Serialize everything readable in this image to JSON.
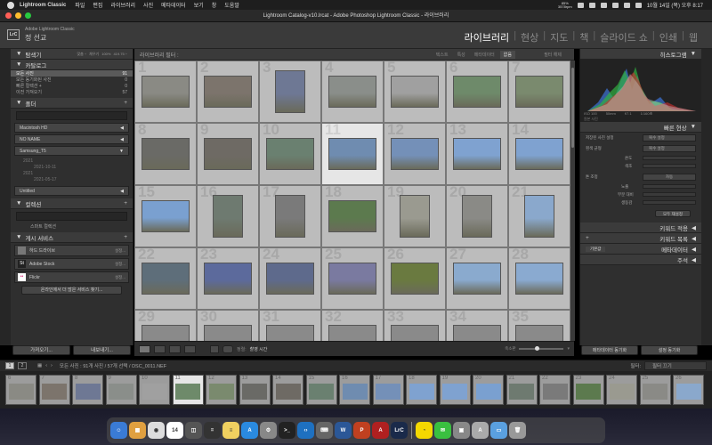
{
  "menubar": {
    "app": "Lightroom Classic",
    "items": [
      "파일",
      "편집",
      "라이브러리",
      "사진",
      "메타데이터",
      "보기",
      "창",
      "도움말"
    ],
    "status_top": "85%",
    "status_bottom": "3578rpm",
    "clock": "10월 14일 (목) 오후 8:17"
  },
  "window": {
    "title": "Lightroom Catalog-v10.lrcat - Adobe Photoshop Lightroom Classic - 라이브러리"
  },
  "identity": {
    "logo": "LrC",
    "brand": "Adobe Lightroom Classic",
    "user": "정 선교"
  },
  "modules": [
    "라이브러리",
    "현상",
    "지도",
    "책",
    "슬라이드 쇼",
    "인쇄",
    "웹"
  ],
  "active_module": "라이브러리",
  "left": {
    "navigator": {
      "title": "탐색기",
      "zoom": [
        "맞춤 ÷",
        "채우기",
        "100%",
        "419.75 ÷"
      ]
    },
    "catalog": {
      "title": "카탈로그",
      "items": [
        {
          "label": "모든 사진",
          "count": "91",
          "selected": true
        },
        {
          "label": "모든 동기화된 사진",
          "count": "0"
        },
        {
          "label": "빠른 컬렉션 +",
          "count": "0"
        },
        {
          "label": "이전 가져오기",
          "count": "57"
        }
      ]
    },
    "folders": {
      "title": "폴더",
      "volumes": [
        "Macintosh HD",
        "NO NAME",
        "Samsung_T5",
        "Untitled"
      ],
      "sub": [
        "2021",
        "2021-10-11",
        "2021",
        "2021-05-17"
      ]
    },
    "collections": {
      "title": "컬렉션",
      "items": [
        "스마트 컬렉션"
      ]
    },
    "publish": {
      "title": "게시 서비스",
      "items": [
        {
          "badge": "",
          "label": "하드 드라이브",
          "set": "설정..."
        },
        {
          "badge": "St",
          "label": "Adobe Stock",
          "set": "설정..."
        },
        {
          "badge": "••",
          "label": "Flickr",
          "set": "설정..."
        }
      ],
      "find_more": "온라인에서 더 많은 서비스 찾기..."
    },
    "import_btn": "가져오기...",
    "export_btn": "내보내기..."
  },
  "filter": {
    "label": "라이브러리 필터 :",
    "tabs": [
      "텍스트",
      "특성",
      "메타데이터",
      "없음"
    ],
    "active_tab": "없음",
    "filter_off": "필터 해제"
  },
  "grid": {
    "cells": [
      {
        "n": "1",
        "c": "#8a8a84"
      },
      {
        "n": "2",
        "c": "#7c746c"
      },
      {
        "n": "3",
        "c": "#6e7894",
        "p": true
      },
      {
        "n": "4",
        "c": "#8a8e8a"
      },
      {
        "n": "5",
        "c": "#a0a0a0"
      },
      {
        "n": "6",
        "c": "#6e8a6a"
      },
      {
        "n": "7",
        "c": "#7a8a6e"
      },
      {
        "n": "8",
        "c": "#6a6a66"
      },
      {
        "n": "9",
        "c": "#6e6a64"
      },
      {
        "n": "10",
        "c": "#6a8070"
      },
      {
        "n": "11",
        "c": "#6f8cb0"
      },
      {
        "n": "12",
        "c": "#7490b8"
      },
      {
        "n": "13",
        "c": "#7fa2d0"
      },
      {
        "n": "14",
        "c": "#7fa2d0"
      },
      {
        "n": "15",
        "c": "#7aa0d0"
      },
      {
        "n": "16",
        "c": "#6e7a70",
        "p": true
      },
      {
        "n": "17",
        "c": "#7a7a7a",
        "p": true
      },
      {
        "n": "18",
        "c": "#5c7a4e"
      },
      {
        "n": "19",
        "c": "#9a9a90",
        "p": true
      },
      {
        "n": "20",
        "c": "#8a8a86",
        "p": true
      },
      {
        "n": "21",
        "c": "#8aa8cc",
        "p": true
      },
      {
        "n": "22",
        "c": "#5e6e7a"
      },
      {
        "n": "23",
        "c": "#5c6a9c"
      },
      {
        "n": "24",
        "c": "#5e6a8c"
      },
      {
        "n": "25",
        "c": "#7a7aa0"
      },
      {
        "n": "26",
        "c": "#6a7a40"
      },
      {
        "n": "27",
        "c": "#8aaace"
      },
      {
        "n": "28",
        "c": "#8aaad0"
      },
      {
        "n": "29",
        "c": "#8a8a8a"
      },
      {
        "n": "30",
        "c": "#8a8a8a"
      },
      {
        "n": "31",
        "c": "#8a8a8a"
      },
      {
        "n": "32",
        "c": "#8a8a8a"
      },
      {
        "n": "33",
        "c": "#8a8a8a"
      },
      {
        "n": "34",
        "c": "#8a8a8a"
      },
      {
        "n": "35",
        "c": "#8a8a8a"
      }
    ],
    "selected": "11"
  },
  "toolbar": {
    "sort_label": "정렬:",
    "sort_value": "촬영 시간",
    "thumb_label": "축소판"
  },
  "right": {
    "histogram": {
      "title": "히스토그램",
      "readout": [
        "ISO 100",
        "50mm",
        "f/7.1",
        "1/160초"
      ],
      "orig": "원본 사진"
    },
    "quick_develop": {
      "title": "빠른 현상",
      "saved_preset": {
        "label": "저장된 사진 설정",
        "value": "복수 설정"
      },
      "white_balance": {
        "label": "흰색 균형",
        "value": "복수 설정"
      },
      "wb_rows": [
        "온도",
        "색조"
      ],
      "tone": {
        "label": "톤 조정",
        "value": "자동"
      },
      "tone_rows": [
        "노출",
        "부분 대비",
        "생동감"
      ],
      "reset": "모두 재설정"
    },
    "sections": [
      "키워드 적용",
      "키워드 목록",
      "메타데이터",
      "주석"
    ],
    "metadata_default": "기본값",
    "metadata_value": "복수 설정",
    "sync_meta": "메타데이터 동기화",
    "sync_settings": "설정 동기화"
  },
  "filmstrip_bar": {
    "pages": [
      "1",
      "2"
    ],
    "path": "모든 사진 : 91개 사진 / 57개 선택 / DSC_0011.NEF",
    "filter_label": "필터:",
    "filter_value": "필터 끄기"
  },
  "filmstrip": [
    "6",
    "7",
    "8",
    "9",
    "10",
    "11",
    "12",
    "13",
    "14",
    "15",
    "16",
    "17",
    "18",
    "19",
    "20",
    "21",
    "22",
    "23",
    "24",
    "25",
    "26"
  ],
  "dock": [
    {
      "n": "Finder",
      "c": "#3a7bd5",
      "t": "☺"
    },
    {
      "n": "Launchpad",
      "c": "#e0a040",
      "t": "▦"
    },
    {
      "n": "Chrome",
      "c": "#dddddd",
      "t": "◉"
    },
    {
      "n": "Calendar",
      "c": "#ffffff",
      "t": "14"
    },
    {
      "n": "Screenshot",
      "c": "#555555",
      "t": "◫"
    },
    {
      "n": "Calculator",
      "c": "#333333",
      "t": "="
    },
    {
      "n": "Notes",
      "c": "#f0d060",
      "t": "≡"
    },
    {
      "n": "AppStore",
      "c": "#2a8ae0",
      "t": "A"
    },
    {
      "n": "Settings",
      "c": "#888888",
      "t": "⚙"
    },
    {
      "n": "Terminal",
      "c": "#222222",
      "t": ">_"
    },
    {
      "n": "VSCode",
      "c": "#1e70c0",
      "t": "‹›"
    },
    {
      "n": "Keyboard",
      "c": "#666666",
      "t": "⌨"
    },
    {
      "n": "Word",
      "c": "#2b5797",
      "t": "W"
    },
    {
      "n": "PowerPoint",
      "c": "#c04020",
      "t": "P"
    },
    {
      "n": "Acrobat",
      "c": "#b02020",
      "t": "A"
    },
    {
      "n": "Lightroom",
      "c": "#1a2a4a",
      "t": "LrC"
    },
    {
      "n": "KakaoTalk",
      "c": "#f5d800",
      "t": "◔"
    },
    {
      "n": "Messages",
      "c": "#3ac040",
      "t": "✉"
    },
    {
      "n": "Preview",
      "c": "#888888",
      "t": "▣"
    },
    {
      "n": "Font",
      "c": "#aaaaaa",
      "t": "A"
    },
    {
      "n": "Folder",
      "c": "#5aa0e0",
      "t": "▭"
    },
    {
      "n": "Trash",
      "c": "#999999",
      "t": "🗑"
    }
  ]
}
